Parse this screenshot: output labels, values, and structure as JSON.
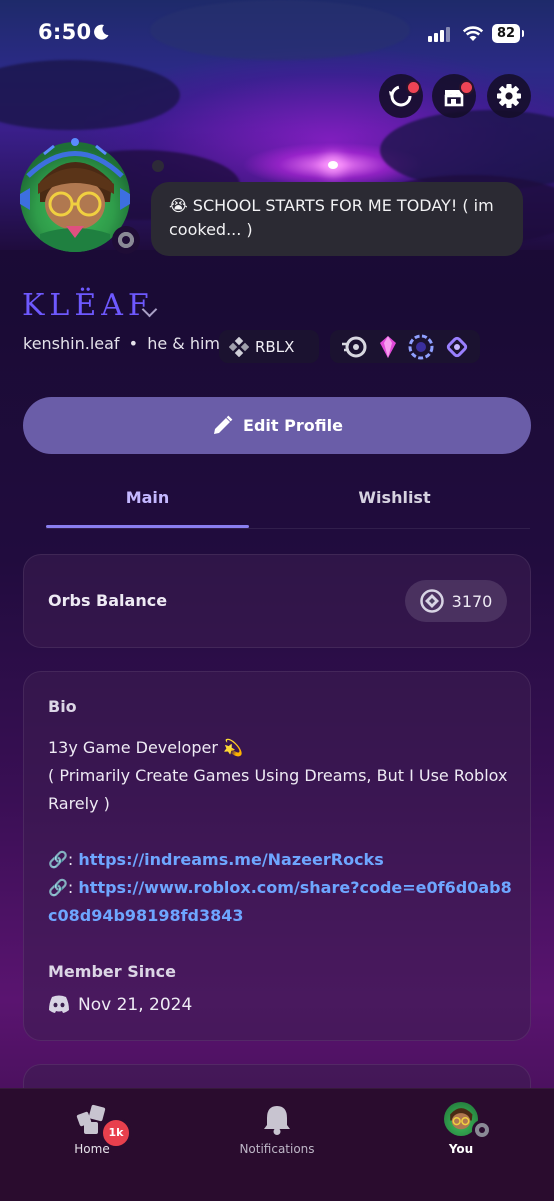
{
  "status_bar": {
    "time": "6:50",
    "battery": "82"
  },
  "profile": {
    "display_name": "KLËAF",
    "username": "kenshin.leaf",
    "separator": "•",
    "pronouns": "he & him.",
    "custom_status": "😭 SCHOOL STARTS FOR ME TODAY! ( im cooked... )",
    "server_tag": "RBLX"
  },
  "actions": {
    "edit_profile": "Edit Profile"
  },
  "tabs": [
    {
      "label": "Main"
    },
    {
      "label": "Wishlist"
    }
  ],
  "orbs": {
    "label": "Orbs Balance",
    "value": "3170"
  },
  "bio": {
    "title": "Bio",
    "line1": "13y Game Developer 💫",
    "line2": "( Primarily Create Games Using Dreams, But I Use Roblox Rarely )",
    "link_prefix": "🔗: ",
    "link1": "https://indreams.me/NazeerRocks",
    "link2": "https://www.roblox.com/share?code=e0f6d0ab8c08d94b98198fd3843",
    "member_since_label": "Member Since",
    "member_since_date": "Nov 21, 2024"
  },
  "bottom_nav": {
    "home": "Home",
    "home_badge": "1k",
    "notifications": "Notifications",
    "you": "You"
  },
  "colors": {
    "accent": "#6a5da8",
    "display_name": "#6e59ff",
    "link": "#6ea6ff",
    "badge": "#e8404d"
  }
}
